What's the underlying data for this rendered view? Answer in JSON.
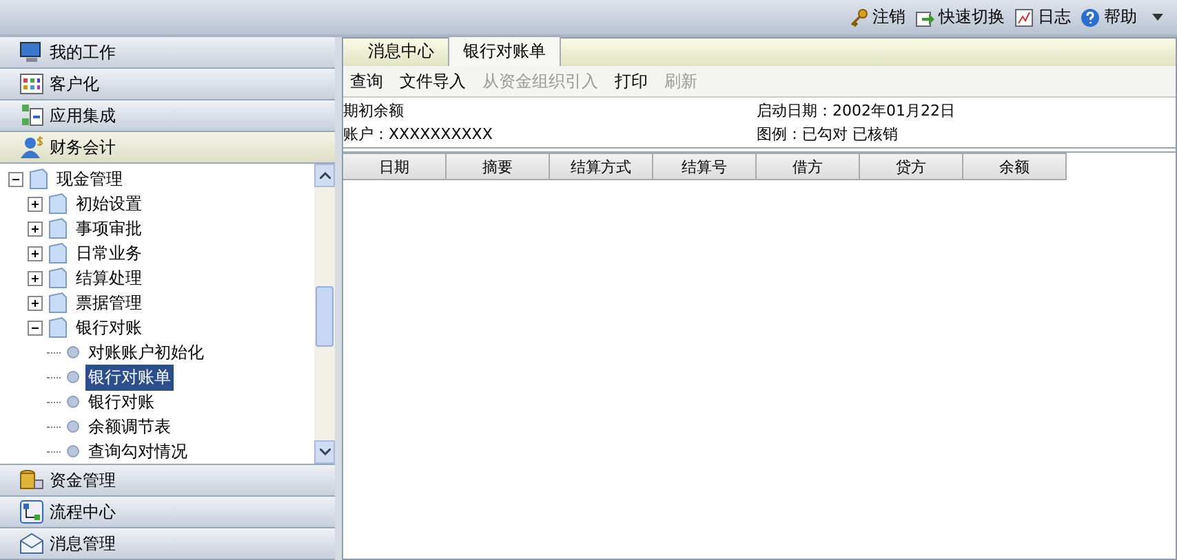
{
  "top_bar": {
    "actions": [
      {
        "kind": "key",
        "label": "注销"
      },
      {
        "kind": "switch",
        "label": "快速切换"
      },
      {
        "kind": "log",
        "label": "日志"
      },
      {
        "kind": "help",
        "label": "帮助"
      }
    ]
  },
  "sidebar": {
    "sections_top": [
      {
        "kind": "computer",
        "label": "我的工作",
        "selected": false
      },
      {
        "kind": "grid",
        "label": "客户化",
        "selected": false
      },
      {
        "kind": "integration",
        "label": "应用集成",
        "selected": false
      },
      {
        "kind": "person",
        "label": "财务会计",
        "selected": true
      }
    ],
    "tree": [
      {
        "kind": "folder",
        "label": "现金管理",
        "expanded": true,
        "children": [
          {
            "kind": "folder",
            "label": "初始设置",
            "expanded": false
          },
          {
            "kind": "folder",
            "label": "事项审批",
            "expanded": false
          },
          {
            "kind": "folder",
            "label": "日常业务",
            "expanded": false
          },
          {
            "kind": "folder",
            "label": "结算处理",
            "expanded": false
          },
          {
            "kind": "folder",
            "label": "票据管理",
            "expanded": false
          },
          {
            "kind": "folder",
            "label": "银行对账",
            "expanded": true,
            "children": [
              {
                "kind": "leaf",
                "label": "对账账户初始化",
                "selected": false
              },
              {
                "kind": "leaf",
                "label": "银行对账单",
                "selected": true
              },
              {
                "kind": "leaf",
                "label": "银行对账",
                "selected": false
              },
              {
                "kind": "leaf",
                "label": "余额调节表",
                "selected": false
              },
              {
                "kind": "leaf",
                "label": "查询勾对情况",
                "selected": false
              }
            ]
          }
        ]
      }
    ],
    "sections_bottom": [
      {
        "kind": "coins",
        "label": "资金管理",
        "selected": false
      },
      {
        "kind": "flow",
        "label": "流程中心",
        "selected": false
      },
      {
        "kind": "mail",
        "label": "消息管理",
        "selected": false
      }
    ]
  },
  "tabs": [
    {
      "label": "消息中心",
      "selected": false
    },
    {
      "label": "银行对账单",
      "selected": true
    }
  ],
  "toolbar": [
    {
      "label": "查询",
      "disabled": false
    },
    {
      "label": "文件导入",
      "disabled": false
    },
    {
      "label": "从资金组织引入",
      "disabled": true
    },
    {
      "label": "打印",
      "disabled": false
    },
    {
      "label": "刷新",
      "disabled": true
    }
  ],
  "info": {
    "left": [
      "期初余额",
      "账户：XXXXXXXXXX"
    ],
    "right": [
      "启动日期：2002年01月22日",
      "图例：已勾对  已核销"
    ]
  },
  "table": {
    "columns": [
      "日期",
      "摘要",
      "结算方式",
      "结算号",
      "借方",
      "贷方",
      "余额"
    ]
  }
}
